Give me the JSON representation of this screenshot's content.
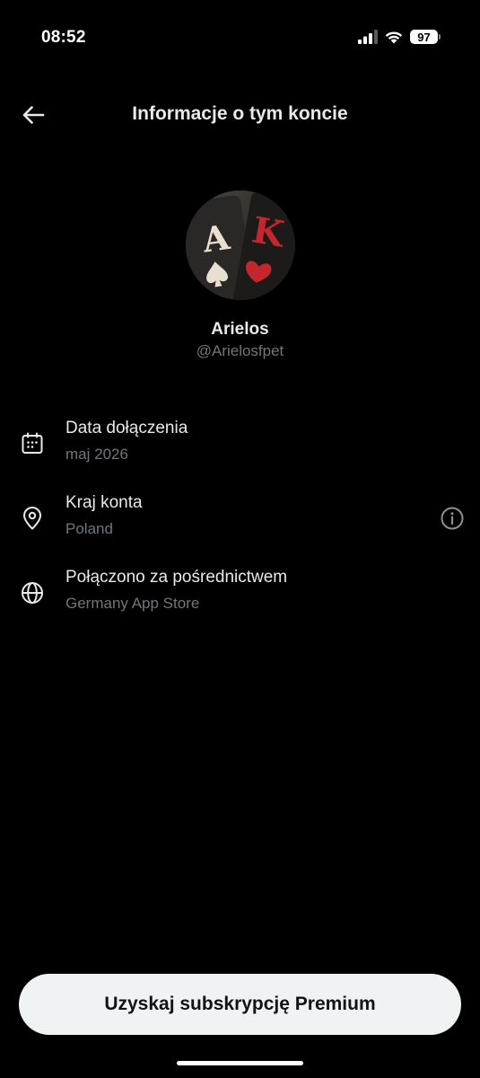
{
  "status_bar": {
    "time": "08:52",
    "battery": "97",
    "icons": [
      "signal-icon",
      "wifi-icon",
      "battery-icon"
    ]
  },
  "header": {
    "title": "Informacje o tym koncie",
    "back_icon": "arrow-left-icon"
  },
  "profile": {
    "name": "Arielos",
    "handle": "@Arielosfpet"
  },
  "rows": [
    {
      "icon": "calendar-icon",
      "title": "Data dołączenia",
      "value": "maj 2026"
    },
    {
      "icon": "location-pin-icon",
      "title": "Kraj konta",
      "value": "Poland",
      "action_icon": "info-icon"
    },
    {
      "icon": "globe-icon",
      "title": "Połączono za pośrednictwem",
      "value": "Germany App Store"
    }
  ],
  "premium_button": {
    "label": "Uzyskaj subskrypcję Premium"
  },
  "colors": {
    "background": "#000000",
    "primary_text": "#e7e9ea",
    "secondary_text": "#71767b",
    "button_bg": "#eff3f4",
    "button_text": "#0f1419"
  }
}
